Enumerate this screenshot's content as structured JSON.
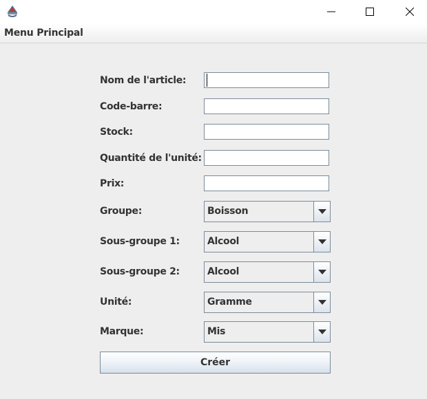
{
  "menubar": {
    "menu_label": "Menu Principal"
  },
  "form": {
    "fields": [
      {
        "label": "Nom de l'article:",
        "value": ""
      },
      {
        "label": "Code-barre:",
        "value": ""
      },
      {
        "label": "Stock:",
        "value": ""
      },
      {
        "label": "Quantité de l'unité:",
        "value": ""
      },
      {
        "label": "Prix:",
        "value": ""
      }
    ],
    "selects": [
      {
        "label": "Groupe:",
        "value": "Boisson"
      },
      {
        "label": "Sous-groupe 1:",
        "value": "Alcool"
      },
      {
        "label": "Sous-groupe 2:",
        "value": "Alcool"
      },
      {
        "label": "Unité:",
        "value": "Gramme"
      },
      {
        "label": "Marque:",
        "value": "Mis"
      }
    ],
    "submit_label": "Créer"
  },
  "icons": {
    "app": "java-cup-icon",
    "minimize": "minimize-icon",
    "maximize": "maximize-icon",
    "close": "close-icon",
    "dropdown": "chevron-down-icon"
  },
  "colors": {
    "background": "#eeeeee",
    "border": "#7a8a99",
    "text": "#333333"
  }
}
